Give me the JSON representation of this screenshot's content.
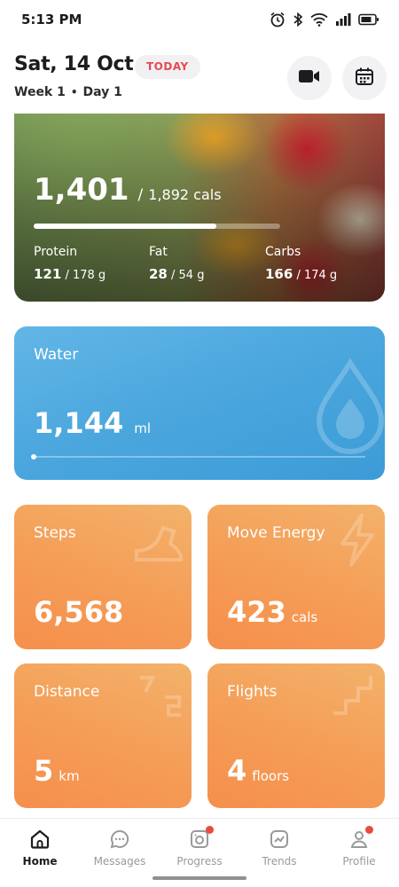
{
  "status_bar": {
    "time": "5:13 PM"
  },
  "header": {
    "date": "Sat, 14 Oct",
    "badge": "TODAY",
    "week": "Week 1",
    "day": "Day 1"
  },
  "nutrition": {
    "consumed": "1,401",
    "separator": "/",
    "target": "1,892 cals",
    "progress_fraction": 0.74,
    "macros": [
      {
        "name": "Protein",
        "value": "121",
        "target": "/ 178 g"
      },
      {
        "name": "Fat",
        "value": "28",
        "target": "/ 54 g"
      },
      {
        "name": "Carbs",
        "value": "166",
        "target": "/ 174 g"
      }
    ]
  },
  "water": {
    "label": "Water",
    "value": "1,144",
    "unit": "ml"
  },
  "metrics": {
    "steps": {
      "label": "Steps",
      "value": "6,568",
      "unit": ""
    },
    "move_energy": {
      "label": "Move Energy",
      "value": "423",
      "unit": "cals"
    },
    "distance": {
      "label": "Distance",
      "value": "5",
      "unit": "km"
    },
    "flights": {
      "label": "Flights",
      "value": "4",
      "unit": "floors"
    }
  },
  "nav": {
    "items": [
      {
        "label": "Home",
        "icon": "home-icon",
        "active": true
      },
      {
        "label": "Messages",
        "icon": "chat-icon",
        "active": false
      },
      {
        "label": "Progress",
        "icon": "camera-icon",
        "active": false,
        "badge": true
      },
      {
        "label": "Trends",
        "icon": "trends-icon",
        "active": false
      },
      {
        "label": "Profile",
        "icon": "profile-icon",
        "active": false,
        "badge": true
      }
    ]
  },
  "colors": {
    "badge_text": "#e8494e",
    "water_card": "#4aa6dd",
    "metric_card": "#f59c56",
    "notification_dot": "#e84c3d"
  }
}
